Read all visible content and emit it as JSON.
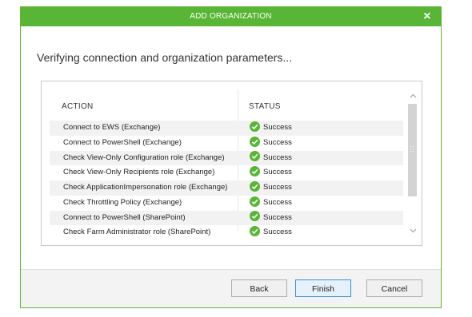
{
  "dialog": {
    "title": "ADD ORGANIZATION",
    "close_symbol": "×",
    "heading": "Verifying connection and organization parameters...",
    "accent_color": "#58b535"
  },
  "table": {
    "headers": {
      "action": "ACTION",
      "status": "STATUS"
    },
    "rows": [
      {
        "action": "Connect to EWS (Exchange)",
        "status": "Success"
      },
      {
        "action": "Connect to PowerShell (Exchange)",
        "status": "Success"
      },
      {
        "action": "Check View-Only Configuration role (Exchange)",
        "status": "Success"
      },
      {
        "action": "Check View-Only Recipients role (Exchange)",
        "status": "Success"
      },
      {
        "action": "Check ApplicationImpersonation role (Exchange)",
        "status": "Success"
      },
      {
        "action": "Check Throttling Policy (Exchange)",
        "status": "Success"
      },
      {
        "action": "Connect to PowerShell (SharePoint)",
        "status": "Success"
      },
      {
        "action": "Check Farm Administrator role (SharePoint)",
        "status": "Success"
      }
    ],
    "status_icon": "check-circle-icon"
  },
  "scrollbar": {
    "up_symbol": "^",
    "down_symbol": "v"
  },
  "footer": {
    "back_label": "Back",
    "finish_label": "Finish",
    "cancel_label": "Cancel"
  }
}
